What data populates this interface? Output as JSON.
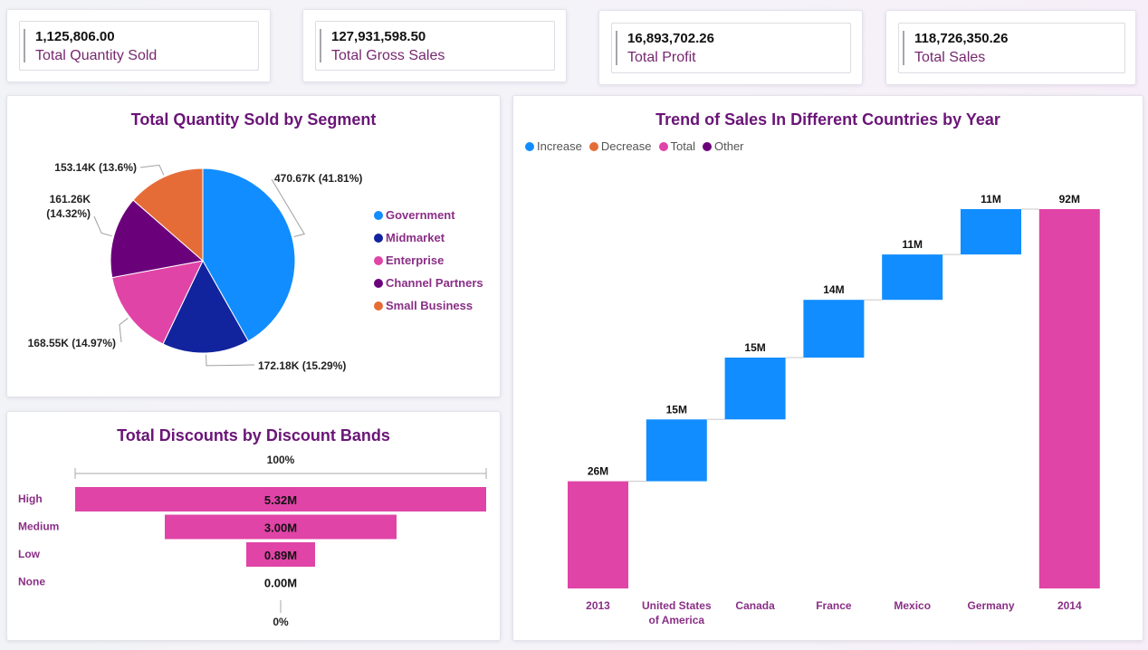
{
  "kpis": [
    {
      "value": "1,125,806.00",
      "label": "Total Quantity Sold"
    },
    {
      "value": "127,931,598.50",
      "label": "Total Gross Sales"
    },
    {
      "value": "16,893,702.26",
      "label": "Total Profit"
    },
    {
      "value": "118,726,350.26",
      "label": "Total Sales"
    }
  ],
  "colors": {
    "title": "#6a1577",
    "label": "#8a2f86",
    "increase": "#118dff",
    "decrease": "#e66c37",
    "total": "#e044a7",
    "other": "#6b007b",
    "government": "#118dff",
    "midmarket": "#12239e",
    "enterprise": "#e044a7",
    "channel_partners": "#6b007b",
    "small_business": "#e66c37"
  },
  "chart_data": [
    {
      "type": "pie",
      "title": "Total Quantity Sold by Segment",
      "legend_position": "right",
      "slices": [
        {
          "name": "Government",
          "value": 470670,
          "label": "470.67K (41.81%)",
          "color": "#118dff"
        },
        {
          "name": "Midmarket",
          "value": 172180,
          "label": "172.18K (15.29%)",
          "color": "#12239e"
        },
        {
          "name": "Enterprise",
          "value": 168550,
          "label": "168.55K (14.97%)",
          "color": "#e044a7"
        },
        {
          "name": "Channel Partners",
          "value": 161260,
          "label_lines": [
            "161.26K",
            "(14.32%)"
          ],
          "color": "#6b007b"
        },
        {
          "name": "Small Business",
          "value": 153140,
          "label": "153.14K (13.6%)",
          "color": "#e66c37"
        }
      ]
    },
    {
      "type": "bar",
      "subtype": "funnel",
      "title": "Total Discounts by Discount Bands",
      "top_label": "100%",
      "bottom_label": "0%",
      "categories": [
        "High",
        "Medium",
        "Low",
        "None"
      ],
      "values": [
        5.32,
        3.0,
        0.89,
        0.0
      ],
      "value_labels": [
        "5.32M",
        "3.00M",
        "0.89M",
        "0.00M"
      ],
      "unit": "M",
      "color": "#e044a7"
    },
    {
      "type": "bar",
      "subtype": "waterfall",
      "title": "Trend of Sales In Different Countries by Year",
      "legend": [
        "Increase",
        "Decrease",
        "Total",
        "Other"
      ],
      "legend_position": "top-left",
      "categories": [
        [
          "2013"
        ],
        [
          "United States",
          "of America"
        ],
        [
          "Canada"
        ],
        [
          "France"
        ],
        [
          "Mexico"
        ],
        [
          "Germany"
        ],
        [
          "2014"
        ]
      ],
      "values": [
        26,
        15,
        15,
        14,
        11,
        11,
        92
      ],
      "kinds": [
        "total",
        "increase",
        "increase",
        "increase",
        "increase",
        "increase",
        "total"
      ],
      "value_labels": [
        "26M",
        "15M",
        "15M",
        "14M",
        "11M",
        "11M",
        "92M"
      ],
      "unit": "M"
    }
  ]
}
